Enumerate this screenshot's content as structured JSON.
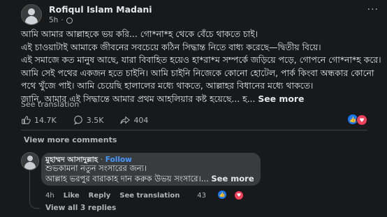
{
  "post": {
    "author": "Rofiqul Islam Madani",
    "time": "5h",
    "more_icon": "more-horizontal-icon",
    "lines": [
      "আমি আমার আল্লাহকে ভয় করি... গো*না*হ থেকে বেঁচে থাকতে চাই।",
      "এই চাওয়াটাই আমাকে জীবনের সবচেয়ে কঠিন সিদ্ধান্ত নিতে বাধ্য করেছে—দ্বিতীয় বিয়ে।",
      "এই সমাজে কত মানুষ আছে, যারা বিবাহিত হয়েও হা*রা*ম সম্পর্কে জড়িয়ে পড়ে, গোপনে গো*না*হ করে।",
      "আমি সেই পথের একজন হতে চাইনি। আমি চাইনি নিজেকে কোনো হোটেল, পার্ক কিংবা অন্ধকার কোনো",
      "পথে খুঁজে পাই। আমি চেয়েছি হালালের মধ্যে থাকতে, আল্লাহর বিধানের মধ্যে থাকতে।",
      "জানি, আমার এই সিদ্ধান্তে আমার প্রথম আহলিয়ার কষ্ট হয়েছে... হ..."
    ],
    "see_more": "See more",
    "see_translation": "See translation"
  },
  "stats": {
    "likes": "14.7K",
    "comments": "3.5K",
    "shares": "404"
  },
  "comments": {
    "view_more": "View more comments",
    "first": {
      "author": "মুহাম্মদ আসাদুল্লাহ",
      "follow": "Follow",
      "separator": "·",
      "lines": [
        "শুভকামনা নতুন সংসারের জন্য।",
        "আল্লাহ ভরপুর বারাকাহ দান করুক উভয় সংসারে।..."
      ],
      "see_more": "See more",
      "time": "4h",
      "like": "Like",
      "reply": "Reply",
      "see_translation": "See translation",
      "reaction_count": "43"
    },
    "view_replies": "View all 3 replies"
  },
  "colors": {
    "background": "#18191a",
    "bubble": "#3a3b3c",
    "like_blue": "#1877f2",
    "love_red": "#f33e58",
    "follow_blue": "#4599ff"
  }
}
